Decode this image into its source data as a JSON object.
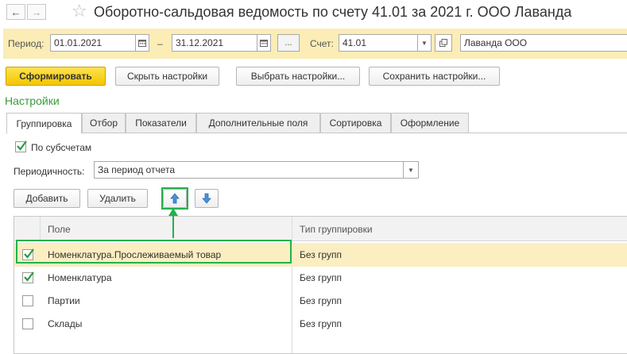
{
  "window": {
    "title": "Оборотно-сальдовая ведомость по счету 41.01 за 2021 г. ООО Лаванда"
  },
  "period_panel": {
    "period_label": "Период:",
    "date_from": "01.01.2021",
    "dash": "–",
    "date_to": "31.12.2021",
    "more_button": "...",
    "account_label": "Счет:",
    "account_value": "41.01",
    "organization_value": "Лаванда ООО"
  },
  "toolbar": {
    "generate": "Сформировать",
    "hide_settings": "Скрыть настройки",
    "choose_settings": "Выбрать настройки...",
    "save_settings": "Сохранить настройки..."
  },
  "settings": {
    "title": "Настройки",
    "tabs": [
      {
        "label": "Группировка",
        "active": true
      },
      {
        "label": "Отбор",
        "active": false
      },
      {
        "label": "Показатели",
        "active": false
      },
      {
        "label": "Дополнительные поля",
        "active": false
      },
      {
        "label": "Сортировка",
        "active": false
      },
      {
        "label": "Оформление",
        "active": false
      }
    ],
    "by_subaccounts_label": "По субсчетам",
    "by_subaccounts_checked": true,
    "periodicity_label": "Периодичность:",
    "periodicity_value": "За период отчета"
  },
  "grid_toolbar": {
    "add": "Добавить",
    "delete": "Удалить"
  },
  "grid": {
    "columns": [
      "Поле",
      "Тип группировки"
    ],
    "rows": [
      {
        "checked": true,
        "field": "Номенклатура.Прослеживаемый товар",
        "type": "Без групп",
        "selected": true
      },
      {
        "checked": true,
        "field": "Номенклатура",
        "type": "Без групп",
        "selected": false
      },
      {
        "checked": false,
        "field": "Партии",
        "type": "Без групп",
        "selected": false
      },
      {
        "checked": false,
        "field": "Склады",
        "type": "Без групп",
        "selected": false
      }
    ]
  },
  "colors": {
    "panel_bg": "#fbedb5",
    "primary_button": "#f2c600",
    "accent_green": "#22b14c",
    "section_title": "#3a9a3a",
    "selected_row": "#fbeec1",
    "arrow_blue": "#4a90d9"
  }
}
